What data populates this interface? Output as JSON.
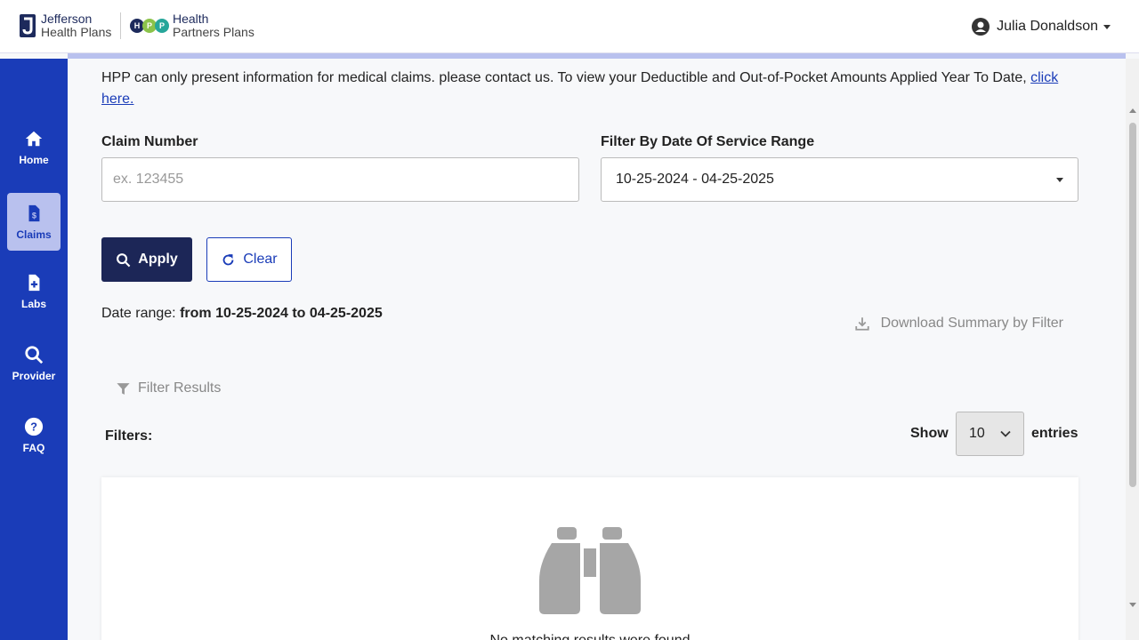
{
  "header": {
    "logo_jefferson": {
      "line1": "Jefferson",
      "line2": "Health Plans"
    },
    "logo_hpp": {
      "dots": [
        "H",
        "P",
        "P"
      ],
      "line1": "Health",
      "line2_bold": "Partners",
      "line2_rest": " Plans"
    },
    "user_name": "Julia Donaldson"
  },
  "sidebar": {
    "items": [
      {
        "label": "Home",
        "icon": "home-icon",
        "active": false
      },
      {
        "label": "Claims",
        "icon": "claims-icon",
        "active": true
      },
      {
        "label": "Labs",
        "icon": "labs-icon",
        "active": false
      },
      {
        "label": "Provider",
        "icon": "search-icon",
        "active": false
      },
      {
        "label": "FAQ",
        "icon": "question-icon",
        "active": false
      }
    ]
  },
  "notice": {
    "text": "HPP can only present information for medical claims. please contact us. To view your Deductible and Out-of-Pocket Amounts Applied Year To Date, ",
    "link": "click here."
  },
  "form": {
    "claim_number_label": "Claim Number",
    "claim_number_placeholder": "ex. 123455",
    "claim_number_value": "",
    "date_filter_label": "Filter By Date Of Service Range",
    "date_filter_value": "10-25-2024 - 04-25-2025",
    "apply_label": "Apply",
    "clear_label": "Clear"
  },
  "date_range": {
    "prefix": "Date range: ",
    "value": "from 10-25-2024 to 04-25-2025"
  },
  "download_label": "Download Summary by Filter",
  "filter_results_label": "Filter Results",
  "filters_label": "Filters:",
  "entries": {
    "show": "Show",
    "value": "10",
    "suffix": "entries"
  },
  "results": {
    "empty_message": "No matching results were found"
  },
  "colors": {
    "sidebar": "#1a3cb8",
    "apply_button": "#1c2657",
    "accent": "#b9c1ee"
  }
}
